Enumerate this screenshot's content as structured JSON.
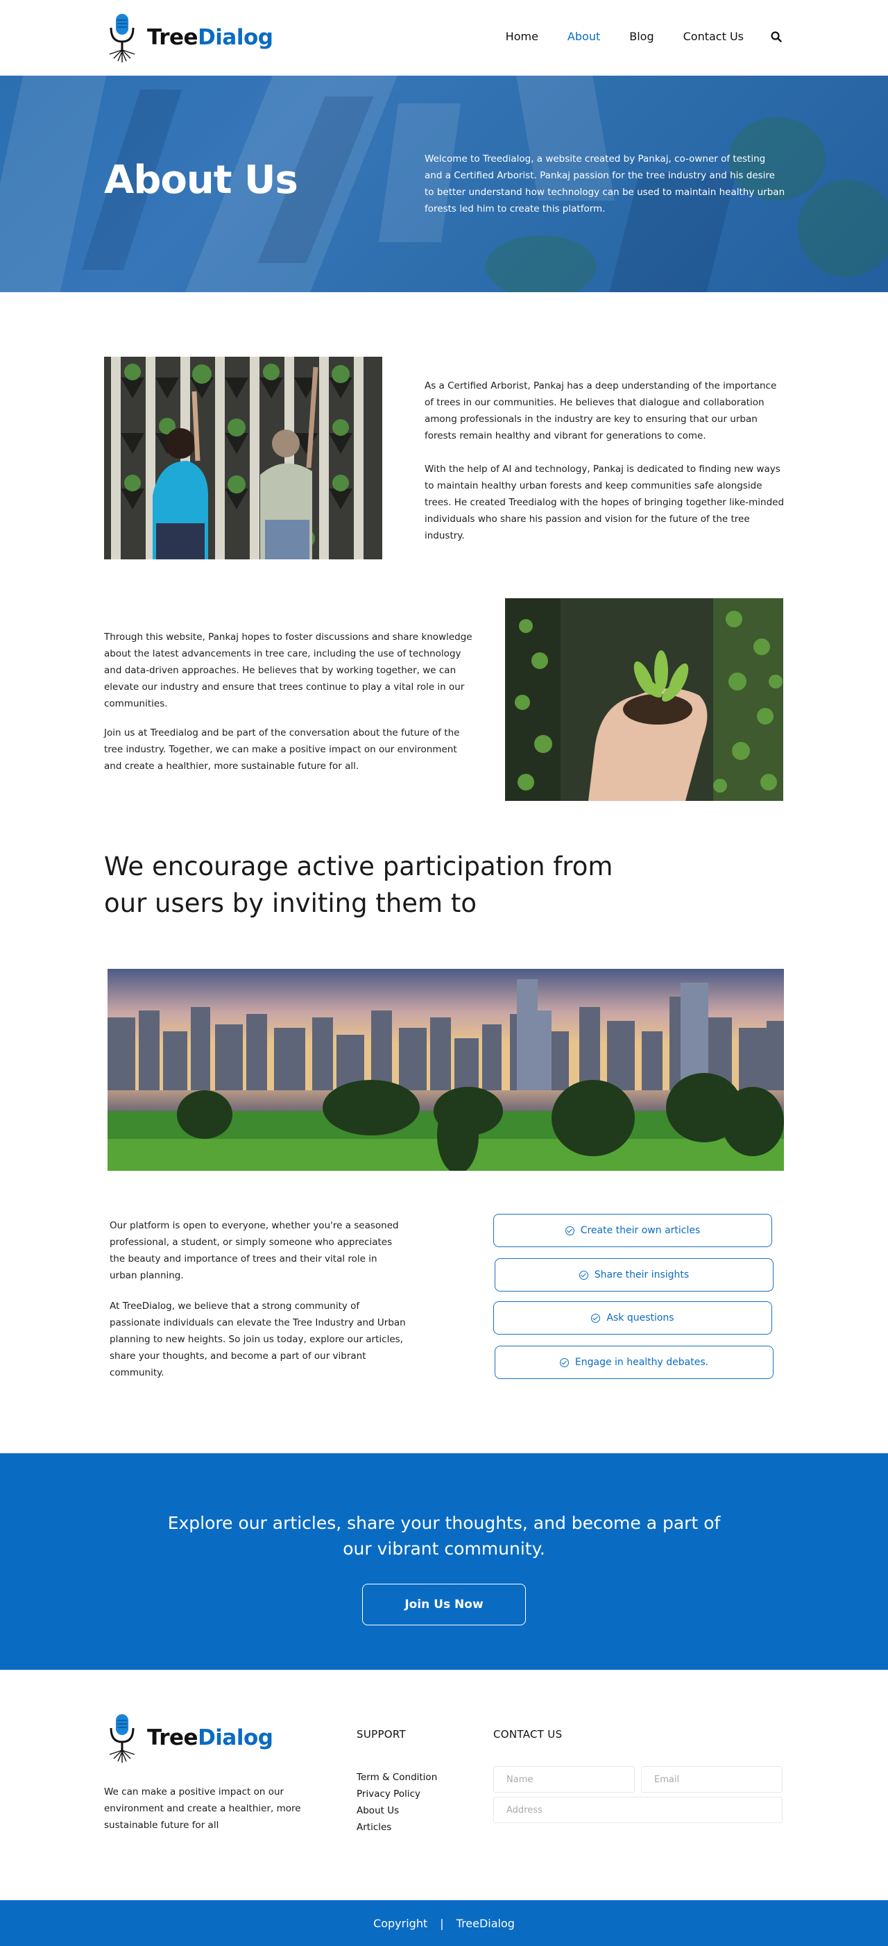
{
  "header": {
    "logo_tree": "Tree",
    "logo_dialog": "Dialog",
    "nav": {
      "home": "Home",
      "about": "About",
      "blog": "Blog",
      "contact": "Contact Us"
    },
    "search_icon": "search-icon"
  },
  "hero": {
    "title": "About Us",
    "text": "Welcome to Treedialog, a website created by Pankaj, co-owner of testing and a Certified Arborist. Pankaj passion for the tree industry and his desire to better understand how technology can be used to maintain healthy urban forests led him to create this platform."
  },
  "section1": {
    "p1": "As a Certified Arborist, Pankaj has a deep understanding of the importance of trees in our communities. He believes that dialogue and collaboration among professionals in the industry are key to ensuring that our urban forests remain healthy and vibrant for generations to come.",
    "p2": "With the help of AI and technology, Pankaj is dedicated to finding new ways to maintain healthy urban forests and keep communities safe alongside trees. He created Treedialog with the hopes of bringing together like-minded individuals who share his passion and vision for the future of the tree industry.",
    "p3": "Through this website, Pankaj hopes to foster discussions and share knowledge about the latest advancements in tree care, including the use of technology and data-driven approaches. He believes that by working together, we can elevate our industry and ensure that trees continue to play a vital role in our communities.",
    "p4": "Join us at Treedialog and be part of the conversation about the future of the tree industry. Together, we can make a positive impact on our environment and create a healthier, more sustainable future for all."
  },
  "section2": {
    "heading": "We encourage active participation from our users by inviting them to",
    "p1": "Our platform is open to everyone, whether you're a seasoned professional, a student, or simply someone who appreciates the beauty and importance of trees and their vital role in urban planning.",
    "p2": "At TreeDialog, we believe that a strong community of passionate individuals can elevate the Tree Industry and Urban planning to new heights. So join us today, explore our articles, share your thoughts, and become a part of our vibrant community.",
    "actions": [
      "Create their own articles",
      "Share their insights",
      "Ask questions",
      "Engage in healthy debates."
    ]
  },
  "cta": {
    "text": "Explore our articles, share your thoughts, and become a part of our vibrant community.",
    "button": "Join Us Now"
  },
  "footer": {
    "logo_tree": "Tree",
    "logo_dialog": "Dialog",
    "description": "We can make a positive impact on our environment and create a healthier, more sustainable future for all",
    "support_title": "SUPPORT",
    "support_links": [
      "Term & Condition",
      "Privacy Policy",
      "About Us",
      "Articles"
    ],
    "contact_title": "CONTACT US",
    "name_placeholder": "Name",
    "email_placeholder": "Email",
    "address_placeholder": "Address",
    "copyright": "Copyright",
    "separator": "|",
    "brand": "TreeDialog"
  },
  "colors": {
    "brand_blue": "#0a6bc3"
  }
}
